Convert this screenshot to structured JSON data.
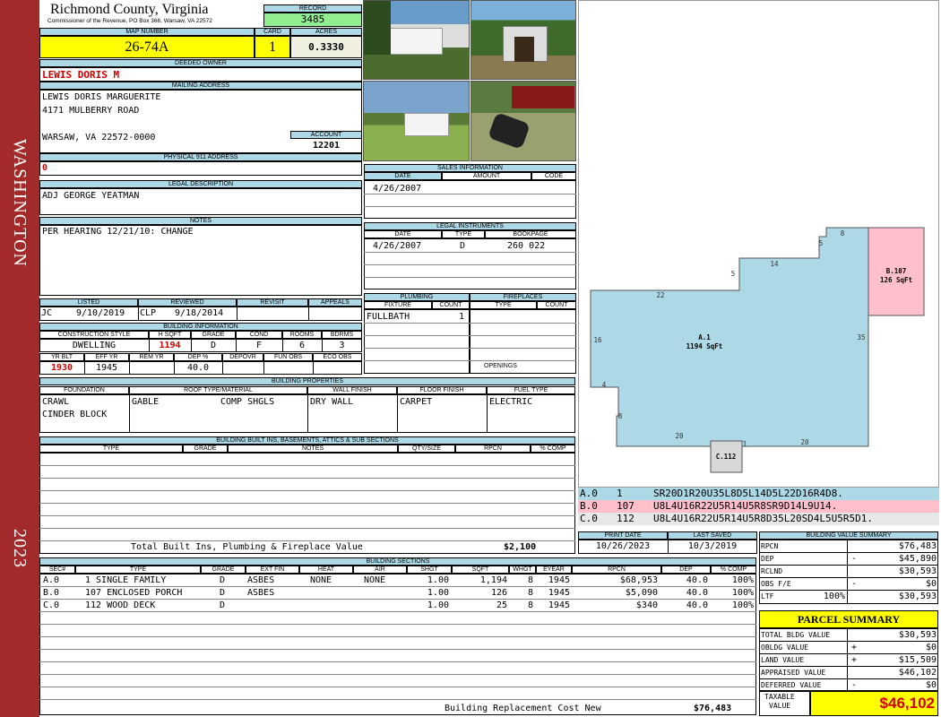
{
  "sidebar": {
    "county_vertical": "WASHINGTON",
    "year": "2023"
  },
  "header": {
    "county": "Richmond County, Virginia",
    "commissioner": "Commissioner of the Revenue, PO Box 366, Warsaw, VA 22572",
    "record_label": "RECORD",
    "record": "3485",
    "map_label": "MAP NUMBER",
    "map_number": "26-74A",
    "card_label": "CARD",
    "card": "1",
    "acres_label": "ACRES",
    "acres": "0.3330"
  },
  "owner": {
    "label": "DEEDED OWNER",
    "name": "LEWIS DORIS M",
    "mailing_label": "MAILING ADDRESS",
    "mail1": "LEWIS DORIS MARGUERITE",
    "mail2": "4171 MULBERRY ROAD",
    "mail3": "WARSAW, VA 22572-0000",
    "account_label": "ACCOUNT",
    "account": "12201",
    "physical_label": "PHYSICAL 911 ADDRESS",
    "physical": "0"
  },
  "legal": {
    "label": "LEGAL DESCRIPTION",
    "text": "ADJ GEORGE YEATMAN"
  },
  "notes": {
    "label": "NOTES",
    "text": "PER HEARING 12/21/10: CHANGE"
  },
  "sales": {
    "label": "SALES INFORMATION",
    "cols": [
      "DATE",
      "AMOUNT",
      "CODE"
    ],
    "date": "4/26/2007"
  },
  "instruments": {
    "label": "LEGAL INSTRUMENTS",
    "cols": [
      "DATE",
      "TYPE",
      "BOOKPAGE"
    ],
    "date": "4/26/2007",
    "type": "D",
    "bookpage": "260 022"
  },
  "review": {
    "cols": [
      "LISTED",
      "REVIEWED",
      "REVISIT",
      "APPEALS"
    ],
    "listed_by": "JC",
    "listed_date": "9/10/2019",
    "reviewed_by": "CLP",
    "reviewed_date": "9/18/2014"
  },
  "plumbing": {
    "label": "PLUMBING",
    "cols": [
      "FIXTURE",
      "COUNT"
    ],
    "fixture": "FULLBATH",
    "count": "1"
  },
  "fireplaces": {
    "label": "FIREPLACES",
    "cols": [
      "TYPE",
      "COUNT"
    ],
    "openings": "OPENINGS"
  },
  "building_info": {
    "label": "BUILDING INFORMATION",
    "cols": [
      "CONSTRUCTION STYLE",
      "H SQFT",
      "GRADE",
      "COND",
      "ROOMS",
      "BDRMS"
    ],
    "style": "DWELLING",
    "hsqft": "1194",
    "grade": "D",
    "cond": "F",
    "rooms": "6",
    "bdrms": "3",
    "cols2": [
      "YR BLT",
      "EFF YR",
      "REM YR",
      "DEP %",
      "DEPOVR",
      "FUN OBS",
      "ECO OBS"
    ],
    "yrblt": "1930",
    "effyr": "1945",
    "dep": "40.0"
  },
  "properties": {
    "label": "BUILDING PROPERTIES",
    "cols": [
      "FOUNDATION",
      "ROOF TYPE/MATERIAL",
      "WALL FINISH",
      "FLOOR FINISH",
      "FUEL TYPE"
    ],
    "foundation1": "CRAWL",
    "foundation2": "CINDER BLOCK",
    "roof_type": "GABLE",
    "roof_mat": "COMP SHGLS",
    "wall": "DRY WALL",
    "floor": "CARPET",
    "fuel": "ELECTRIC"
  },
  "builtins": {
    "label": "BUILDING BUILT INS, BASEMENTS, ATTICS & SUB SECTIONS",
    "cols": [
      "TYPE",
      "GRADE",
      "NOTES",
      "QTY/SIZE",
      "RPCN",
      "% COMP"
    ],
    "total_label": "Total Built Ins, Plumbing & Fireplace Value",
    "total": "$2,100"
  },
  "sections": {
    "label": "BUILDING SECTIONS",
    "cols": [
      "SEC#",
      "TYPE",
      "GRADE",
      "EXT FIN",
      "HEAT",
      "AIR",
      "SHGT",
      "SQFT",
      "WHGT",
      "EYEAR",
      "RPCN",
      "DEP",
      "% COMP"
    ],
    "rows": [
      {
        "sec": "A.0",
        "type": "1 SINGLE FAMILY",
        "grade": "D",
        "ext": "ASBES",
        "heat": "NONE",
        "air": "NONE",
        "shgt": "1.00",
        "sqft": "1,194",
        "whgt": "8",
        "eyear": "1945",
        "rpcn": "$68,953",
        "dep": "40.0",
        "comp": "100%"
      },
      {
        "sec": "B.0",
        "type": "107 ENCLOSED PORCH",
        "grade": "D",
        "ext": "ASBES",
        "heat": "",
        "air": "",
        "shgt": "1.00",
        "sqft": "126",
        "whgt": "8",
        "eyear": "1945",
        "rpcn": "$5,090",
        "dep": "40.0",
        "comp": "100%"
      },
      {
        "sec": "C.0",
        "type": "112 WOOD DECK",
        "grade": "D",
        "ext": "",
        "heat": "",
        "air": "",
        "shgt": "1.00",
        "sqft": "25",
        "whgt": "8",
        "eyear": "1945",
        "rpcn": "$340",
        "dep": "40.0",
        "comp": "100%"
      }
    ],
    "replacement_label": "Building Replacement Cost New",
    "replacement": "$76,483"
  },
  "sketch": {
    "a_label": "A.1",
    "a_sqft": "1194 SqFt",
    "b_label": "B.107",
    "b_sqft": "126 SqFt",
    "c_label": "C.112",
    "dims": [
      "8",
      "5",
      "14",
      "5",
      "22",
      "16",
      "35",
      "4",
      "8",
      "20",
      "1",
      "20"
    ],
    "codes": [
      {
        "sec": "A.0",
        "num": "1",
        "code": "SR20D1R20U35L8D5L14D5L22D16R4D8.",
        "color": "#add8e6"
      },
      {
        "sec": "B.0",
        "num": "107",
        "code": "U8L4U16R22U5R14U5R8SR9D14L9U14.",
        "color": "#ffc0cb"
      },
      {
        "sec": "C.0",
        "num": "112",
        "code": "U8L4U16R22U5R14U5R8D35L20SD4L5U5R5D1.",
        "color": "#e8e8e8"
      }
    ]
  },
  "dates": {
    "print_label": "PRINT DATE",
    "print": "10/26/2023",
    "saved_label": "LAST SAVED",
    "saved": "10/3/2019"
  },
  "value_summary": {
    "label": "BUILDING VALUE SUMMARY",
    "rpcn_label": "RPCN",
    "rpcn": "$76,483",
    "dep_label": "DEP",
    "dep_sign": "-",
    "dep": "$45,890",
    "rclnd_label": "RCLND",
    "rclnd": "$30,593",
    "obs_label": "OBS F/E",
    "obs_sign": "-",
    "obs": "$0",
    "ltf_label": "LTF",
    "ltf_pct": "100%",
    "ltf": "$30,593"
  },
  "parcel": {
    "label": "PARCEL SUMMARY",
    "total_bldg_label": "TOTAL BLDG VALUE",
    "total_bldg": "$30,593",
    "obldg_label": "OBLDG VALUE",
    "obldg_sign": "+",
    "obldg": "$0",
    "land_label": "LAND VALUE",
    "land_sign": "+",
    "land": "$15,509",
    "appraised_label": "APPRAISED VALUE",
    "appraised": "$46,102",
    "deferred_label": "DEFERRED VALUE",
    "deferred_sign": "-",
    "deferred": "$0",
    "taxable_label1": "TAXABLE",
    "taxable_label2": "VALUE",
    "taxable": "$46,102"
  }
}
